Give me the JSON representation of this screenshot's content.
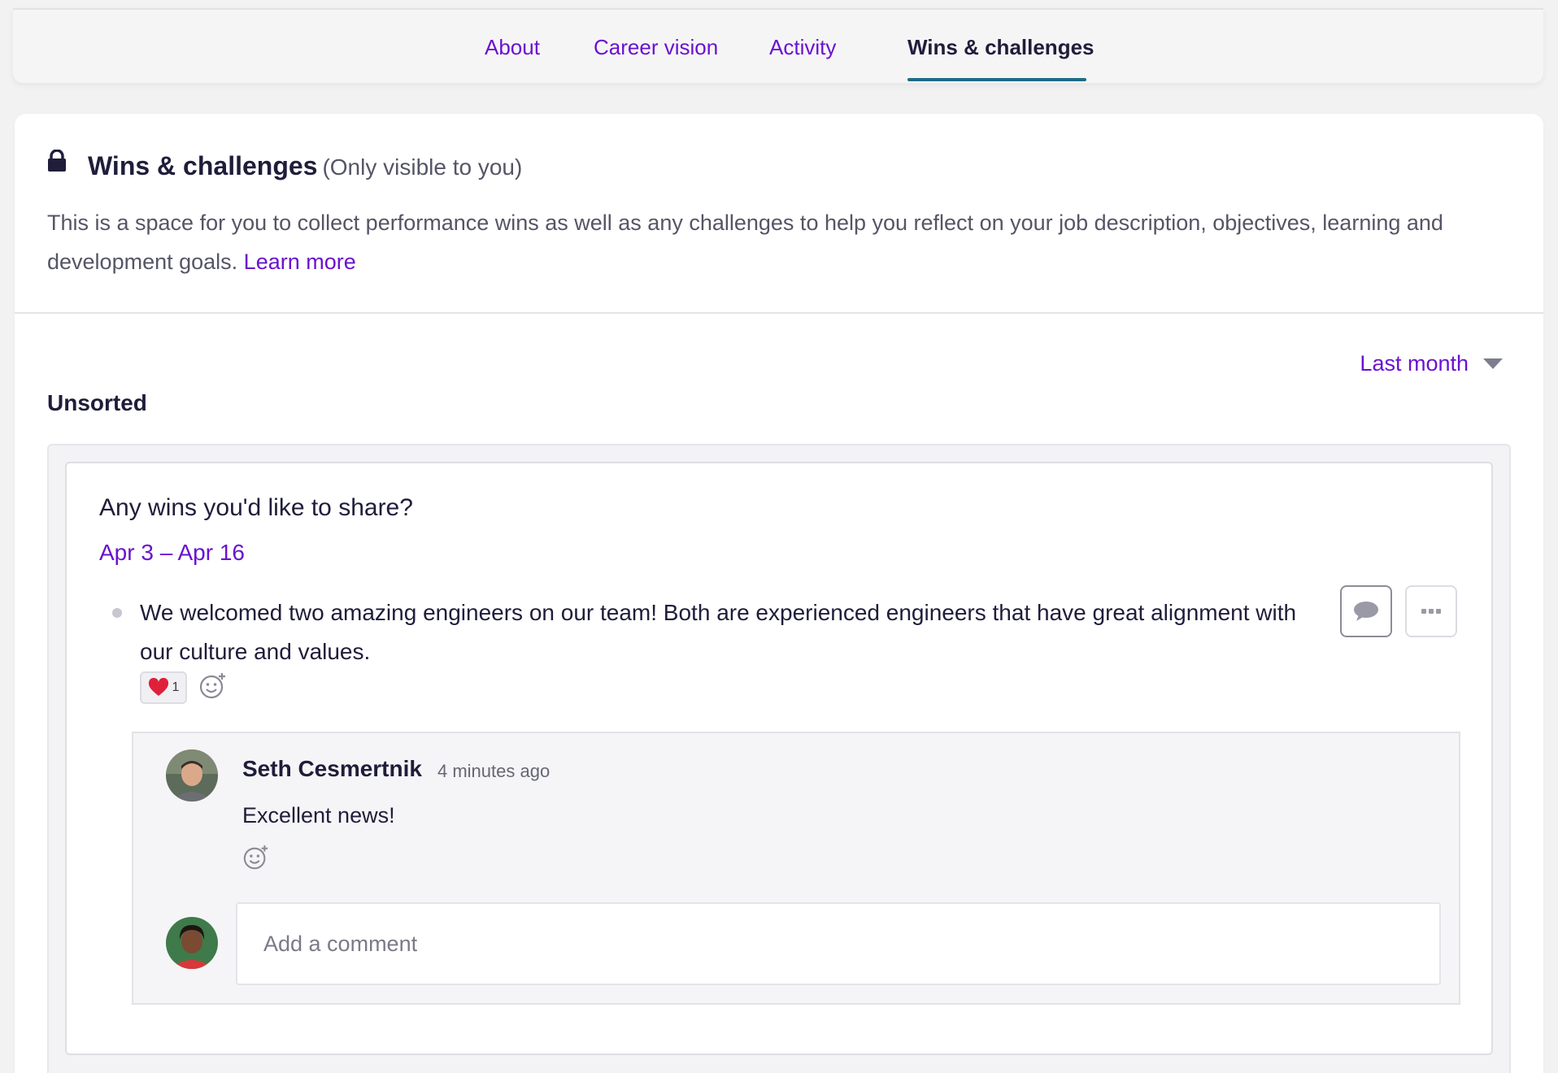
{
  "tabs": [
    {
      "label": "About"
    },
    {
      "label": "Career vision"
    },
    {
      "label": "Activity"
    },
    {
      "label": "Wins & challenges"
    }
  ],
  "section": {
    "title": "Wins & challenges",
    "visibility": "(Only visible to you)",
    "description": "This is a space for you to collect performance wins as well as any challenges to help you reflect on your job description, objectives, learning and development goals.",
    "learn_more": "Learn more"
  },
  "filter": {
    "selected": "Last month"
  },
  "group_label": "Unsorted",
  "prompt": {
    "question": "Any wins you'd like to share?",
    "date_range": "Apr 3 – Apr 16"
  },
  "win": {
    "text": "We welcomed two amazing engineers on our team! Both are experienced engineers that have great alignment with our culture and values.",
    "reaction_count": "1"
  },
  "comment": {
    "author": "Seth Cesmertnik",
    "time": "4 minutes ago",
    "text": "Excellent news!"
  },
  "new_comment": {
    "placeholder": "Add a comment"
  },
  "colors": {
    "accent": "#6a12cf",
    "tab_underline": "#1f6b86",
    "heart": "#e0203a"
  }
}
